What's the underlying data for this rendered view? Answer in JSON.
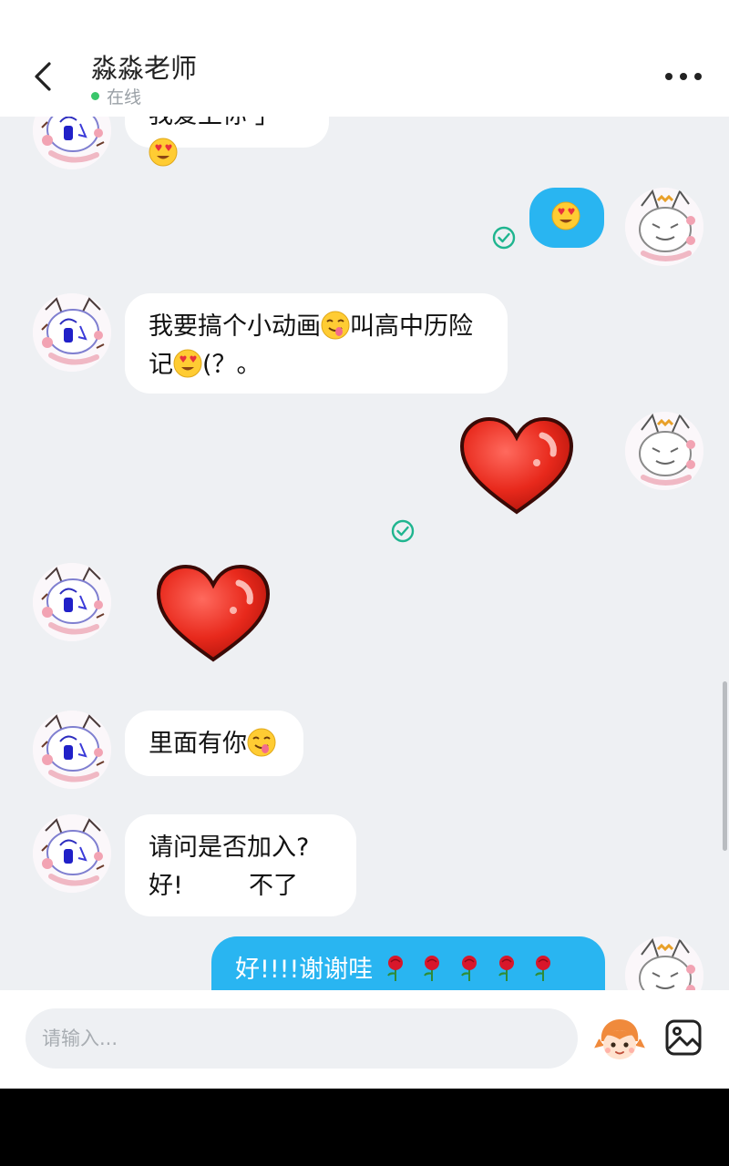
{
  "header": {
    "title": "淼淼老师",
    "status": "在线"
  },
  "messages": {
    "m1_text": "我爱上你",
    "m3_line1": "我要搞个小动画",
    "m3_line1b": "叫高中历险",
    "m3_line2a": "记",
    "m3_line2b": "(？。",
    "m6_text": "里面有你",
    "m7_line1": "请问是否加入?",
    "m7_opt_yes": "好!",
    "m7_opt_no": "不了",
    "m8_text": "好!!!!谢谢哇"
  },
  "input": {
    "placeholder": "请输入..."
  },
  "icons": {
    "back": "chevron-left-icon",
    "more": "more-dots-icon",
    "check": "check-circle-icon",
    "sticker": "sticker-face-icon",
    "image": "image-icon"
  },
  "colors": {
    "incoming_bubble": "#ffffff",
    "outgoing_bubble": "#29b5f1",
    "online": "#3ac66b",
    "read_check": "#1fb58f",
    "background": "#eef0f3"
  }
}
